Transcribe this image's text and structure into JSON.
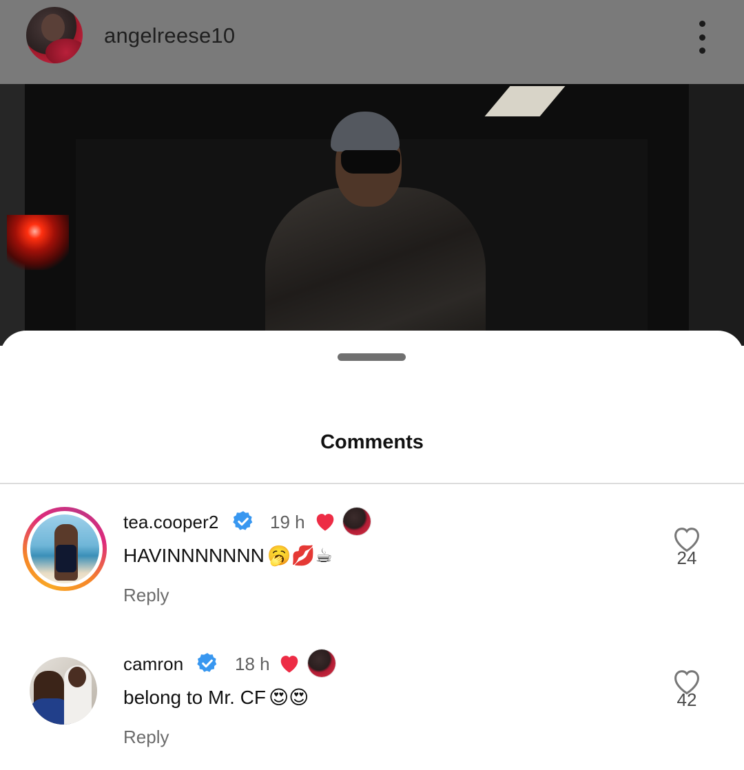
{
  "post": {
    "username": "angelreese10",
    "more_icon": "more-vertical-icon"
  },
  "sheet": {
    "title": "Comments"
  },
  "comments": [
    {
      "username": "tea.cooper2",
      "verified": true,
      "time": "19 h",
      "liked_by_author": true,
      "text": "HAVINNNNNNN",
      "emojis": "🥱💋☕",
      "reply_label": "Reply",
      "like_count": "24"
    },
    {
      "username": "camron",
      "verified": true,
      "time": "18 h",
      "liked_by_author": true,
      "text": "belong to Mr. CF",
      "emojis": "😍😍",
      "reply_label": "Reply",
      "like_count": "42"
    }
  ],
  "colors": {
    "verified": "#3897f0",
    "heart": "#ed2c45",
    "story_ring": [
      "#f9a825",
      "#dd2a7b"
    ]
  }
}
